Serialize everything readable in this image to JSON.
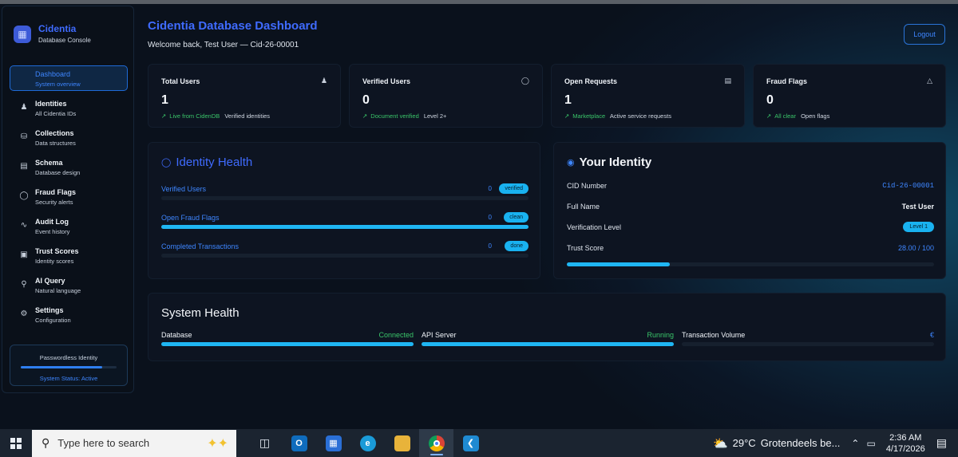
{
  "brand": {
    "title": "Cidentia",
    "subtitle": "Database Console"
  },
  "sidebar": {
    "items": [
      {
        "label": "Dashboard",
        "sub": "System overview",
        "icon": "grid-icon",
        "active": true
      },
      {
        "label": "Identities",
        "sub": "All Cidentia IDs",
        "icon": "users-icon"
      },
      {
        "label": "Collections",
        "sub": "Data structures",
        "icon": "database-icon"
      },
      {
        "label": "Schema",
        "sub": "Database design",
        "icon": "document-icon"
      },
      {
        "label": "Fraud Flags",
        "sub": "Security alerts",
        "icon": "shield-icon"
      },
      {
        "label": "Audit Log",
        "sub": "Event history",
        "icon": "activity-icon"
      },
      {
        "label": "Trust Scores",
        "sub": "Identity scores",
        "icon": "award-icon"
      },
      {
        "label": "AI Query",
        "sub": "Natural language",
        "icon": "search-icon"
      },
      {
        "label": "Settings",
        "sub": "Configuration",
        "icon": "gear-icon"
      }
    ],
    "passwordless": {
      "title": "Passwordless Identity",
      "status": "System Status: Active",
      "progress": 0.85
    }
  },
  "header": {
    "title": "Cidentia Database Dashboard",
    "welcome": "Welcome back, Test User — Cid-26-00001",
    "logout_label": "Logout"
  },
  "stats": [
    {
      "title": "Total Users",
      "value": "1",
      "trend": "Live from CidenDB",
      "note": "Verified identities",
      "icon": "users-icon"
    },
    {
      "title": "Verified Users",
      "value": "0",
      "trend": "Document verified",
      "note": "Level 2+",
      "icon": "shield-icon"
    },
    {
      "title": "Open Requests",
      "value": "1",
      "trend": "Marketplace",
      "note": "Active service requests",
      "icon": "briefcase-icon"
    },
    {
      "title": "Fraud Flags",
      "value": "0",
      "trend": "All clear",
      "note": "Open flags",
      "icon": "warning-icon"
    }
  ],
  "identity_health": {
    "title": "Identity Health",
    "rows": [
      {
        "label": "Verified Users",
        "count": "0",
        "pill": "verified",
        "fill": 0.0
      },
      {
        "label": "Open Fraud Flags",
        "count": "0",
        "pill": "clean",
        "fill": 1.0
      },
      {
        "label": "Completed Transactions",
        "count": "0",
        "pill": "done",
        "fill": 0.0
      }
    ]
  },
  "your_identity": {
    "title": "Your Identity",
    "cid_label": "CID Number",
    "cid_value": "Cid-26-00001",
    "name_label": "Full Name",
    "name_value": "Test User",
    "level_label": "Verification Level",
    "level_value": "Level 1",
    "score_label": "Trust Score",
    "score_value": "28.00 / 100",
    "score_fraction": 0.28
  },
  "system_health": {
    "title": "System Health",
    "items": [
      {
        "label": "Database",
        "status": "Connected",
        "fill": 1.0
      },
      {
        "label": "API Server",
        "status": "Running",
        "fill": 1.0
      },
      {
        "label": "Transaction Volume",
        "status": "",
        "fill": 0.0
      }
    ]
  },
  "taskbar": {
    "search_placeholder": "Type here to search",
    "weather_temp": "29°C",
    "weather_text": "Grotendeels be...",
    "time": "2:36 AM",
    "date": "4/17/2026"
  },
  "colors": {
    "accent": "#3f6bff",
    "cyan": "#1fb6f3",
    "green": "#3ac66a",
    "panel": "#0d1421"
  }
}
